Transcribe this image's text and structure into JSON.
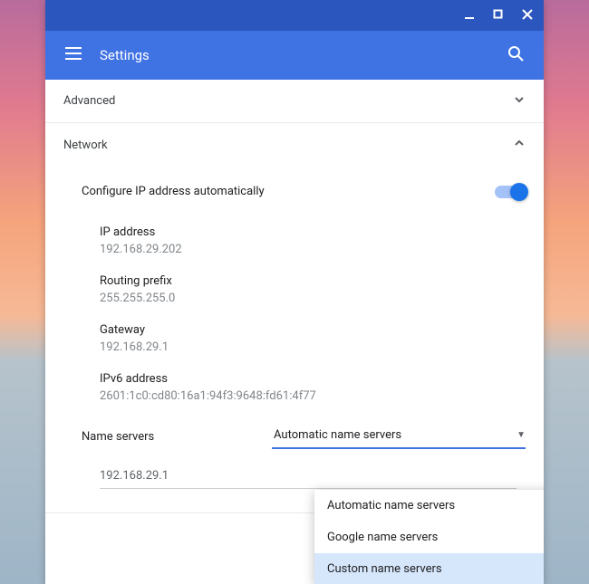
{
  "appbar": {
    "title": "Settings"
  },
  "sections": {
    "advanced": {
      "label": "Advanced"
    },
    "network": {
      "label": "Network"
    }
  },
  "configure_ip": {
    "label": "Configure IP address automatically"
  },
  "fields": {
    "ip": {
      "label": "IP address",
      "value": "192.168.29.202"
    },
    "prefix": {
      "label": "Routing prefix",
      "value": "255.255.255.0"
    },
    "gateway": {
      "label": "Gateway",
      "value": "192.168.29.1"
    },
    "ipv6": {
      "label": "IPv6 address",
      "value": "2601:1c0:cd80:16a1:94f3:9648:fd61:4f77"
    }
  },
  "name_servers": {
    "label": "Name servers",
    "selected": "Automatic name servers",
    "value_field": "192.168.29.1",
    "options": {
      "auto": "Automatic name servers",
      "google": "Google name servers",
      "custom": "Custom name servers"
    }
  }
}
